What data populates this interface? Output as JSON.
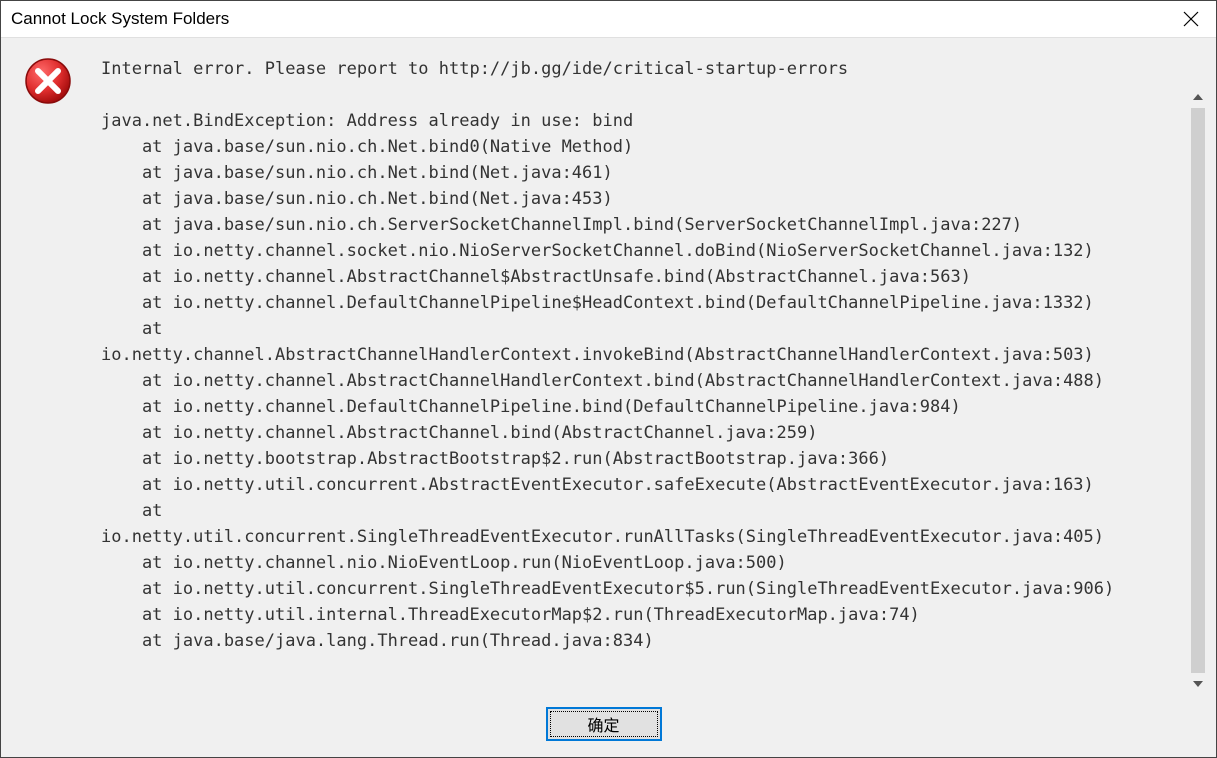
{
  "dialog": {
    "title": "Cannot Lock System Folders",
    "ok_label": "确定",
    "message": "Internal error. Please report to http://jb.gg/ide/critical-startup-errors\n\njava.net.BindException: Address already in use: bind\n    at java.base/sun.nio.ch.Net.bind0(Native Method)\n    at java.base/sun.nio.ch.Net.bind(Net.java:461)\n    at java.base/sun.nio.ch.Net.bind(Net.java:453)\n    at java.base/sun.nio.ch.ServerSocketChannelImpl.bind(ServerSocketChannelImpl.java:227)\n    at io.netty.channel.socket.nio.NioServerSocketChannel.doBind(NioServerSocketChannel.java:132)\n    at io.netty.channel.AbstractChannel$AbstractUnsafe.bind(AbstractChannel.java:563)\n    at io.netty.channel.DefaultChannelPipeline$HeadContext.bind(DefaultChannelPipeline.java:1332)\n    at\nio.netty.channel.AbstractChannelHandlerContext.invokeBind(AbstractChannelHandlerContext.java:503)\n    at io.netty.channel.AbstractChannelHandlerContext.bind(AbstractChannelHandlerContext.java:488)\n    at io.netty.channel.DefaultChannelPipeline.bind(DefaultChannelPipeline.java:984)\n    at io.netty.channel.AbstractChannel.bind(AbstractChannel.java:259)\n    at io.netty.bootstrap.AbstractBootstrap$2.run(AbstractBootstrap.java:366)\n    at io.netty.util.concurrent.AbstractEventExecutor.safeExecute(AbstractEventExecutor.java:163)\n    at\nio.netty.util.concurrent.SingleThreadEventExecutor.runAllTasks(SingleThreadEventExecutor.java:405)\n    at io.netty.channel.nio.NioEventLoop.run(NioEventLoop.java:500)\n    at io.netty.util.concurrent.SingleThreadEventExecutor$5.run(SingleThreadEventExecutor.java:906)\n    at io.netty.util.internal.ThreadExecutorMap$2.run(ThreadExecutorMap.java:74)\n    at java.base/java.lang.Thread.run(Thread.java:834)"
  }
}
